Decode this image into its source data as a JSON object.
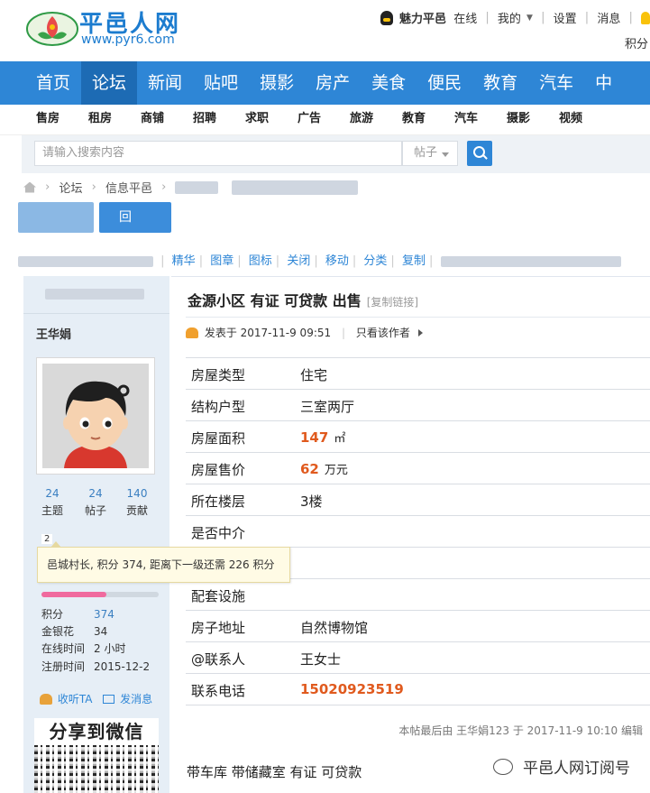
{
  "site": {
    "name": "平邑人网",
    "url": "www.pyr6.com"
  },
  "userbar": {
    "username": "魅力平邑",
    "status": "在线",
    "my": "我的",
    "settings": "设置",
    "messages": "消息",
    "points": "积分"
  },
  "nav": [
    "首页",
    "论坛",
    "新闻",
    "贴吧",
    "摄影",
    "房产",
    "美食",
    "便民",
    "教育",
    "汽车",
    "中"
  ],
  "subnav": [
    "售房",
    "租房",
    "商铺",
    "招聘",
    "求职",
    "广告",
    "旅游",
    "教育",
    "汽车",
    "摄影",
    "视频"
  ],
  "search": {
    "placeholder": "请输入搜索内容",
    "type": "帖子"
  },
  "breadcrumb": {
    "forum": "论坛",
    "board": "信息平邑"
  },
  "reply_button": "回",
  "toolbar": [
    "精华",
    "图章",
    "图标",
    "关闭",
    "移动",
    "分类",
    "复制"
  ],
  "user": {
    "name": "王华娟",
    "stats": [
      {
        "value": "24",
        "label": "主题"
      },
      {
        "value": "24",
        "label": "帖子"
      },
      {
        "value": "140",
        "label": "贡献"
      }
    ],
    "level": "2",
    "tooltip": "邑城村长, 积分 374, 距离下一级还需 226 积分",
    "progress": 0.55,
    "details": [
      {
        "k": "积分",
        "v": "374"
      },
      {
        "k": "金银花",
        "v": "34"
      },
      {
        "k": "在线时间",
        "v": "2 小时"
      },
      {
        "k": "注册时间",
        "v": "2015-12-2"
      }
    ],
    "follow": "收听TA",
    "message": "发消息",
    "share_wechat": "分享到微信"
  },
  "post": {
    "title": "金源小区 有证 可贷款 出售",
    "copy_link": "[复制链接]",
    "posted_at": "发表于 2017-11-9 09:51",
    "only_author": "只看该作者",
    "edit_note": "本帖最后由 王华娟123 于 2017-11-9 10:10 编辑",
    "body": "带车库  带储藏室  有证  可贷款",
    "watermark": "平邑人网订阅号"
  },
  "info_rows": [
    {
      "label": "房屋类型",
      "value": "住宅",
      "unit": ""
    },
    {
      "label": "结构户型",
      "value": "三室两厅",
      "unit": ""
    },
    {
      "label": "房屋面积",
      "value": "147",
      "unit": "㎡"
    },
    {
      "label": "房屋售价",
      "value": "62",
      "unit": "万元"
    },
    {
      "label": "所在楼层",
      "value": "3楼",
      "unit": ""
    },
    {
      "label": "是否中介",
      "value": "",
      "unit": ""
    },
    {
      "label": "",
      "value": "",
      "unit": ""
    },
    {
      "label": "配套设施",
      "value": "",
      "unit": ""
    },
    {
      "label": "房子地址",
      "value": "自然博物馆",
      "unit": ""
    },
    {
      "label": "@联系人",
      "value": "王女士",
      "unit": ""
    },
    {
      "label": "联系电话",
      "value": "15020923519",
      "unit": ""
    }
  ],
  "colors": {
    "nav_bg": "#2e86d6",
    "nav_active": "#1d6bb4",
    "accent_orange": "#e05a1e",
    "link_blue": "#2e86d6"
  }
}
